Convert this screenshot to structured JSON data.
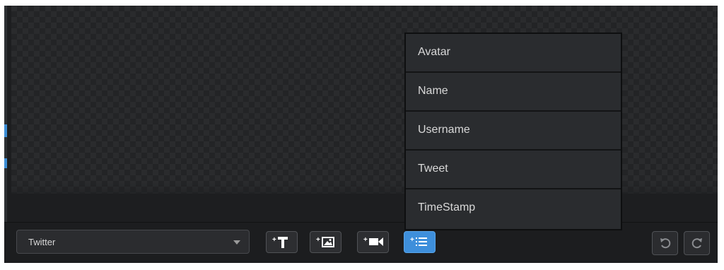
{
  "source_select": {
    "value": "Twitter"
  },
  "toolbar": {
    "add_text": {
      "plus": "+",
      "icon": "text-T-icon"
    },
    "add_image": {
      "plus": "+",
      "icon": "image-icon"
    },
    "add_video": {
      "plus": "+",
      "icon": "video-camera-icon"
    },
    "add_field": {
      "plus": "+",
      "icon": "list-icon",
      "active": true
    },
    "undo": {
      "icon": "undo-icon"
    },
    "redo": {
      "icon": "redo-icon"
    }
  },
  "field_menu": {
    "items": [
      {
        "label": "Avatar"
      },
      {
        "label": "Name"
      },
      {
        "label": "Username"
      },
      {
        "label": "Tweet"
      },
      {
        "label": "TimeStamp"
      }
    ]
  },
  "colors": {
    "accent": "#3e8fdb",
    "panel": "#1d1e20",
    "menu": "#2a2c2f",
    "text": "#d9d9d9"
  }
}
